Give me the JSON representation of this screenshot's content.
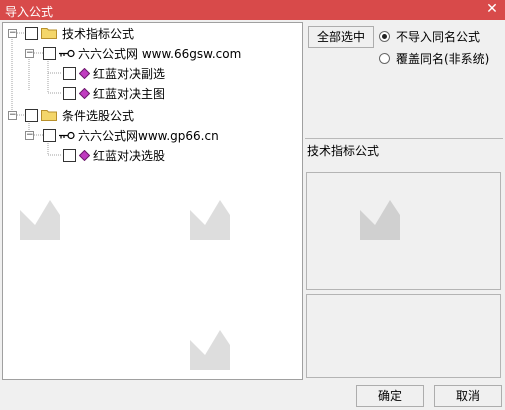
{
  "window": {
    "title": "导入公式",
    "close_glyph": "✕"
  },
  "tree": {
    "nodes": [
      {
        "label": "技术指标公式"
      },
      {
        "label": "六六公式网 www.66gsw.com"
      },
      {
        "label": "红蓝对决副选"
      },
      {
        "label": "红蓝对决主图"
      },
      {
        "label": "条件选股公式"
      },
      {
        "label": "六六公式网www.gp66.cn"
      },
      {
        "label": "红蓝对决选股"
      }
    ]
  },
  "options": {
    "select_all_label": "全部选中",
    "radio_skip_label": "不导入同名公式",
    "radio_overwrite_label": "覆盖同名(非系统)",
    "selected": "skip"
  },
  "info_label": "技术指标公式",
  "buttons": {
    "ok_label": "确定",
    "cancel_label": "取消"
  },
  "colors": {
    "titlebar": "#d84a4a",
    "folder": "#f4d66a",
    "formula_icon": "#c03cc0"
  },
  "icons": {
    "folder": "folder-icon",
    "formula": "formula-diamond-icon",
    "link": "key-link-icon",
    "close": "close-icon"
  }
}
